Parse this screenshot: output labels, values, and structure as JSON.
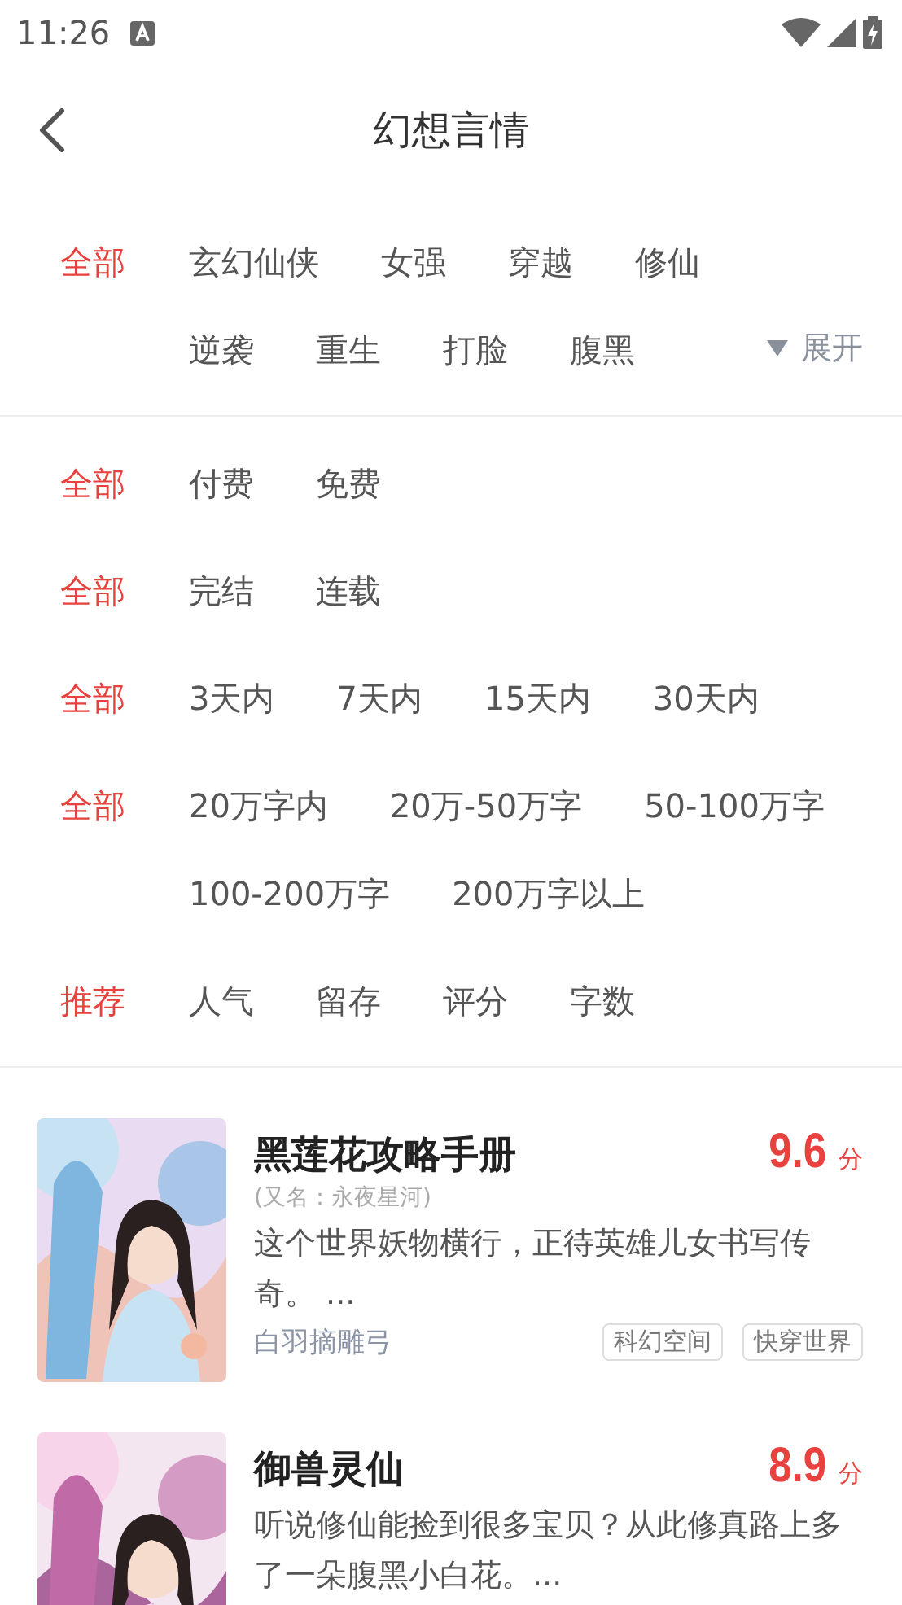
{
  "status_bar": {
    "time": "11:26"
  },
  "header": {
    "title": "幻想言情"
  },
  "filter_groups": [
    {
      "options": [
        {
          "label": "全部",
          "selected": true
        },
        {
          "label": "玄幻仙侠",
          "selected": false
        },
        {
          "label": "女强",
          "selected": false
        },
        {
          "label": "穿越",
          "selected": false
        },
        {
          "label": "修仙",
          "selected": false
        },
        {
          "label": "逆袭",
          "selected": false
        },
        {
          "label": "重生",
          "selected": false
        },
        {
          "label": "打脸",
          "selected": false
        },
        {
          "label": "腹黑",
          "selected": false
        }
      ],
      "expand": {
        "label": "展开",
        "expanded": false
      }
    },
    {
      "options": [
        {
          "label": "全部",
          "selected": true
        },
        {
          "label": "付费",
          "selected": false
        },
        {
          "label": "免费",
          "selected": false
        }
      ]
    },
    {
      "options": [
        {
          "label": "全部",
          "selected": true
        },
        {
          "label": "完结",
          "selected": false
        },
        {
          "label": "连载",
          "selected": false
        }
      ]
    },
    {
      "options": [
        {
          "label": "全部",
          "selected": true
        },
        {
          "label": "3天内",
          "selected": false
        },
        {
          "label": "7天内",
          "selected": false
        },
        {
          "label": "15天内",
          "selected": false
        },
        {
          "label": "30天内",
          "selected": false
        }
      ]
    },
    {
      "options": [
        {
          "label": "全部",
          "selected": true
        },
        {
          "label": "20万字内",
          "selected": false
        },
        {
          "label": "20万-50万字",
          "selected": false
        },
        {
          "label": "50-100万字",
          "selected": false
        },
        {
          "label": "100-200万字",
          "selected": false
        },
        {
          "label": "200万字以上",
          "selected": false
        }
      ]
    },
    {
      "options": [
        {
          "label": "推荐",
          "selected": true
        },
        {
          "label": "人气",
          "selected": false
        },
        {
          "label": "留存",
          "selected": false
        },
        {
          "label": "评分",
          "selected": false
        },
        {
          "label": "字数",
          "selected": false
        }
      ]
    }
  ],
  "books": [
    {
      "title": "黑莲花攻略手册",
      "alias": "(又名：永夜星河)",
      "description": "这个世界妖物横行，正待英雄儿女书写传奇。 ...",
      "author": "白羽摘雕弓",
      "tags": [
        "科幻空间",
        "快穿世界"
      ],
      "score": "9.6",
      "score_unit": "分",
      "cover": {
        "kind": "picture"
      }
    },
    {
      "title": "御兽灵仙",
      "description": "听说修仙能捡到很多宝贝？从此修真路上多了一朵腹黑小白花。...",
      "score": "8.9",
      "score_unit": "分",
      "cover": {
        "kind": "picture"
      }
    }
  ]
}
